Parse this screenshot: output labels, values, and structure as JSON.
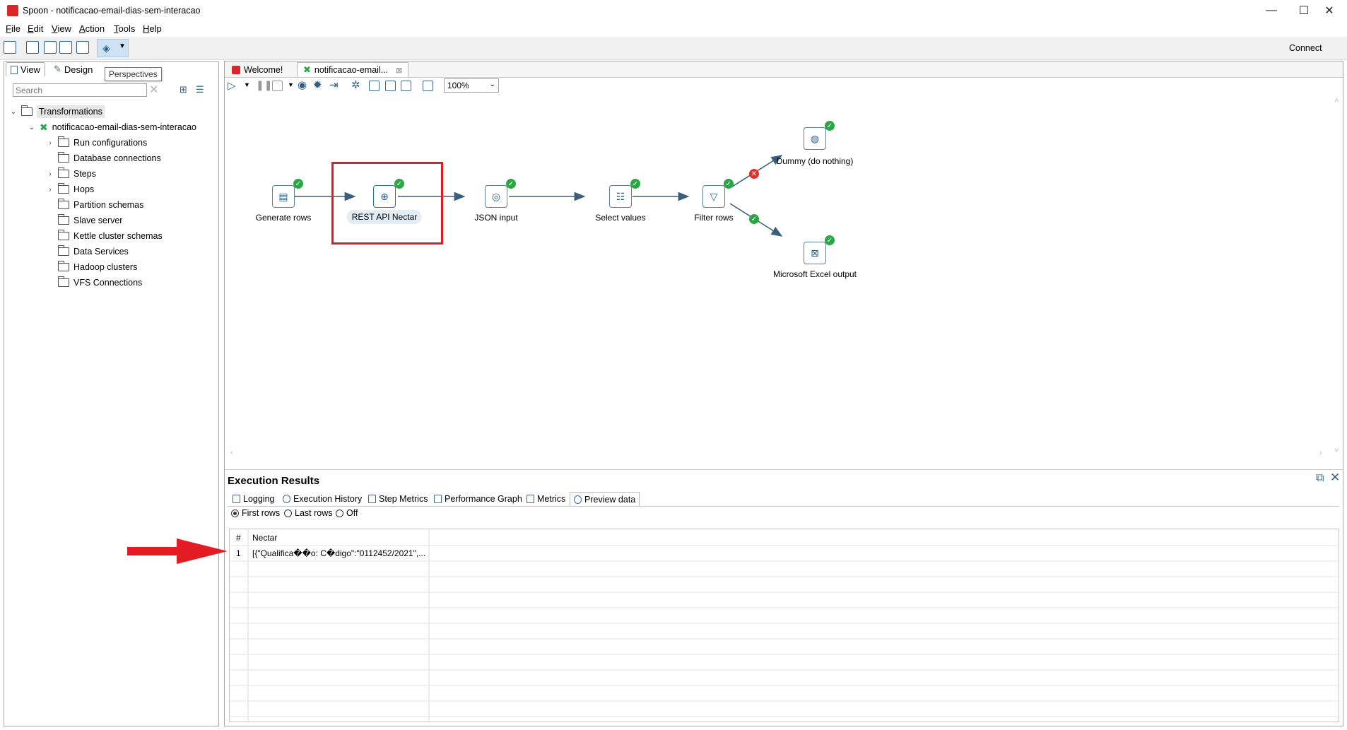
{
  "window": {
    "title": "Spoon - notificacao-email-dias-sem-interacao",
    "buttons": [
      "—",
      "☐",
      "✕"
    ]
  },
  "menubar": [
    "File",
    "Edit",
    "View",
    "Action",
    "Tools",
    "Help"
  ],
  "toolbar": {
    "connect_label": "Connect",
    "tooltip": "Perspectives"
  },
  "left_panel": {
    "tabs": [
      "View",
      "Design"
    ],
    "search_placeholder": "Search",
    "root": "Transformations",
    "transformation": "notificacao-email-dias-sem-interacao",
    "items": [
      {
        "label": "Run configurations",
        "expandable": true
      },
      {
        "label": "Database connections",
        "expandable": false
      },
      {
        "label": "Steps",
        "expandable": true
      },
      {
        "label": "Hops",
        "expandable": true
      },
      {
        "label": "Partition schemas",
        "expandable": false
      },
      {
        "label": "Slave server",
        "expandable": false
      },
      {
        "label": "Kettle cluster schemas",
        "expandable": false
      },
      {
        "label": "Data Services",
        "expandable": false
      },
      {
        "label": "Hadoop clusters",
        "expandable": false
      },
      {
        "label": "VFS Connections",
        "expandable": false
      }
    ]
  },
  "editor": {
    "tabs": [
      "Welcome!",
      "notificacao-email..."
    ],
    "zoom": "100%",
    "steps": [
      "Generate rows",
      "REST API Nectar",
      "JSON input",
      "Select values",
      "Filter rows",
      "Dummy (do nothing)",
      "Microsoft Excel output"
    ]
  },
  "results": {
    "title": "Execution Results",
    "tabs": [
      "Logging",
      "Execution History",
      "Step Metrics",
      "Performance Graph",
      "Metrics",
      "Preview data"
    ],
    "radios": [
      "First rows",
      "Last rows",
      "Off"
    ],
    "grid": {
      "columns": [
        "#",
        "Nectar"
      ],
      "rows": [
        [
          "1",
          "[{\"Qualifica��o: C�digo\":\"0112452/2021\",..."
        ]
      ]
    }
  },
  "colors": {
    "accent_red": "#e31b23",
    "ok_green": "#2aa745",
    "hop": "#3a5f7d"
  }
}
